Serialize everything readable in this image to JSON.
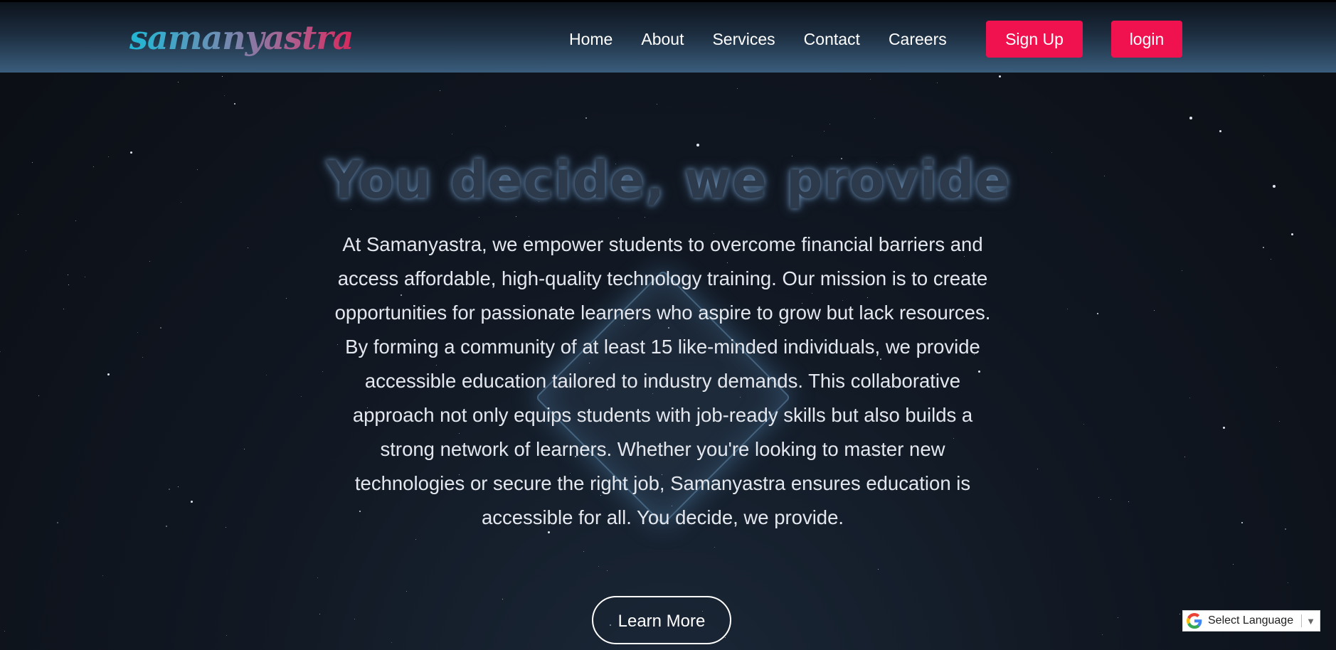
{
  "brand": {
    "logo_text": "samanyastra"
  },
  "nav": {
    "items": [
      {
        "label": "Home"
      },
      {
        "label": "About"
      },
      {
        "label": "Services"
      },
      {
        "label": "Contact"
      },
      {
        "label": "Careers"
      }
    ],
    "signup_label": "Sign Up",
    "login_label": "login"
  },
  "hero": {
    "title": "You decide, we provide",
    "body": "At Samanyastra, we empower students to overcome financial barriers and access affordable, high-quality technology training. Our mission is to create opportunities for passionate learners who aspire to grow but lack resources. By forming a community of at least 15 like-minded individuals, we provide accessible education tailored to industry demands. This collaborative approach not only equips students with job-ready skills but also builds a strong network of learners. Whether you're looking to master new technologies or secure the right job, Samanyastra ensures education is accessible for all. You decide, we provide.",
    "cta_label": "Learn More"
  },
  "translate": {
    "label": "Select Language",
    "icon": "google-g-icon",
    "arrow": "▼"
  },
  "colors": {
    "accent": "#f0124f",
    "header_top": "#0d131c",
    "header_bottom": "#3a5d7c",
    "background": "#0c0f16"
  }
}
